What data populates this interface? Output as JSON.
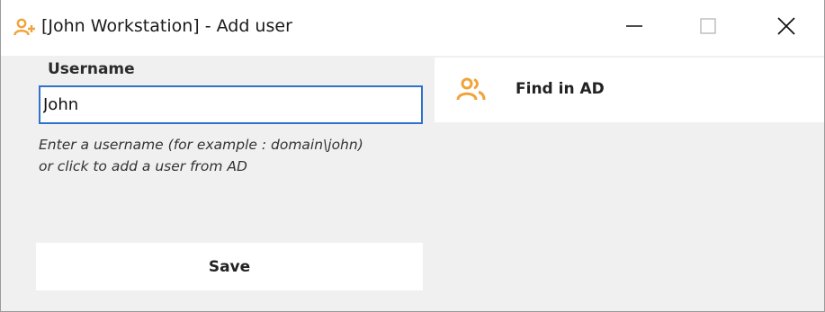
{
  "window": {
    "title": "[John Workstation] - Add user",
    "icon": "add-user-icon",
    "controls": {
      "minimize": "minimize-icon",
      "maximize": "maximize-icon",
      "close": "close-icon"
    }
  },
  "form": {
    "username_label": "Username",
    "username_value": "John",
    "hint_line1": "Enter a username (for example : domain\\john)",
    "hint_line2": "or click to add a user from AD",
    "save_label": "Save"
  },
  "find_ad": {
    "label": "Find in AD",
    "icon": "users-icon"
  },
  "colors": {
    "accent_orange": "#f0a33a",
    "input_border": "#2f73c9",
    "panel_bg": "#f0f0f0"
  }
}
